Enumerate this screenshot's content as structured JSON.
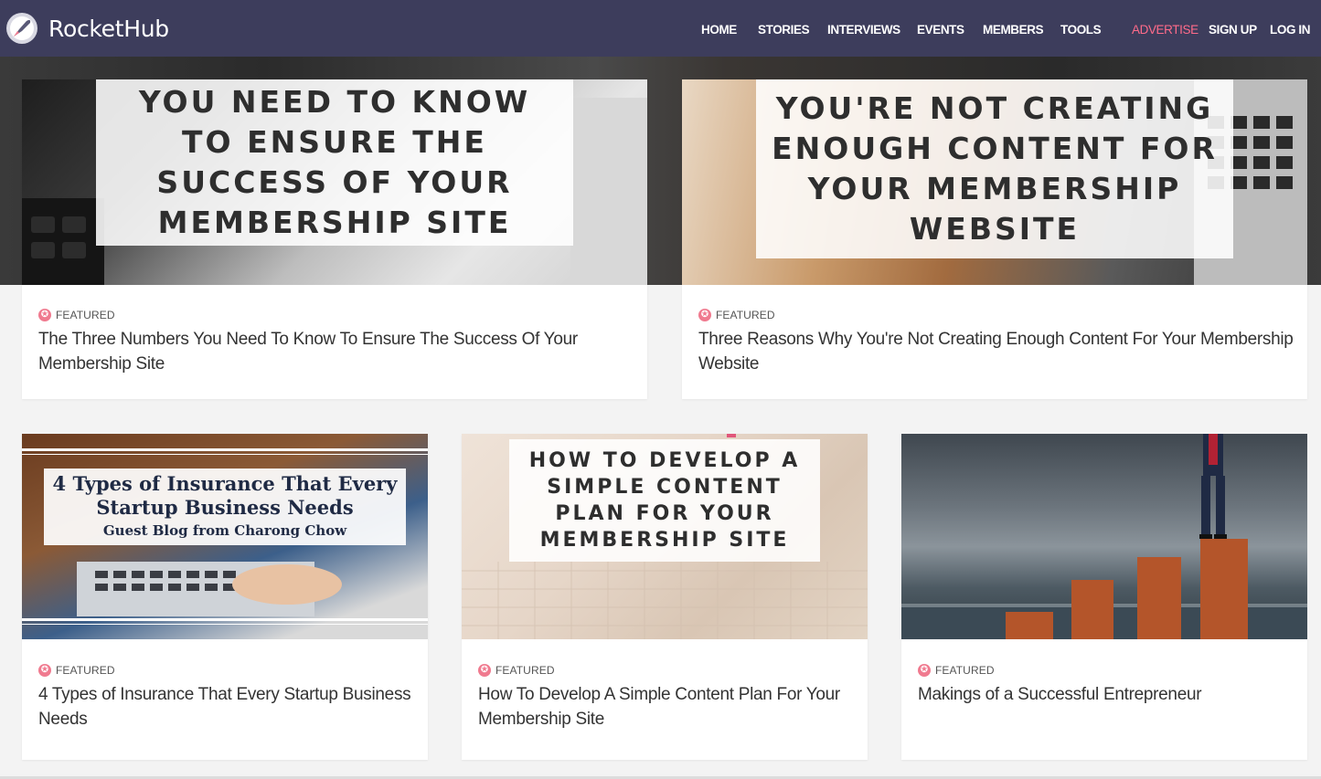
{
  "site": {
    "name": "RocketHub"
  },
  "nav": {
    "items": [
      "HOME",
      "STORIES",
      "INTERVIEWS",
      "EVENTS",
      "MEMBERS",
      "TOOLS"
    ],
    "advertise": "ADVERTISE",
    "signup": "SIGN UP",
    "login": "LOG IN",
    "advertise_color": "#ff6b8a"
  },
  "colors": {
    "nav_bg": "#3d3d5c",
    "page_bg": "#f3f3f3",
    "badge": "#f07a8f"
  },
  "featured_label": "FEATURED",
  "cards": [
    {
      "overlay": "YOU NEED TO KNOW TO ENSURE THE SUCCESS OF YOUR MEMBERSHIP SITE",
      "title": "The Three Numbers You Need To Know To Ensure The Success Of Your Membership Site",
      "icon": "calculator-photo"
    },
    {
      "overlay": "YOU'RE NOT CREATING ENOUGH CONTENT FOR YOUR MEMBERSHIP WEBSITE",
      "title": "Three Reasons Why You're Not Creating Enough Content For Your Membership Website",
      "icon": "laptop-photo"
    },
    {
      "overlay_line1": "4 Types of Insurance That Every",
      "overlay_line2": "Startup Business Needs",
      "overlay_line3": "Guest Blog from Charong Chow",
      "title": "4 Types of Insurance That Every Startup Business Needs",
      "icon": "typing-laptop-photo"
    },
    {
      "overlay": "HOW TO DEVELOP A SIMPLE CONTENT PLAN FOR YOUR MEMBERSHIP SITE",
      "title": "How To Develop A Simple Content Plan For Your Membership Site",
      "icon": "notebook-photo"
    },
    {
      "title": "Makings of a Successful Entrepreneur",
      "icon": "businessman-on-bars-photo"
    }
  ]
}
